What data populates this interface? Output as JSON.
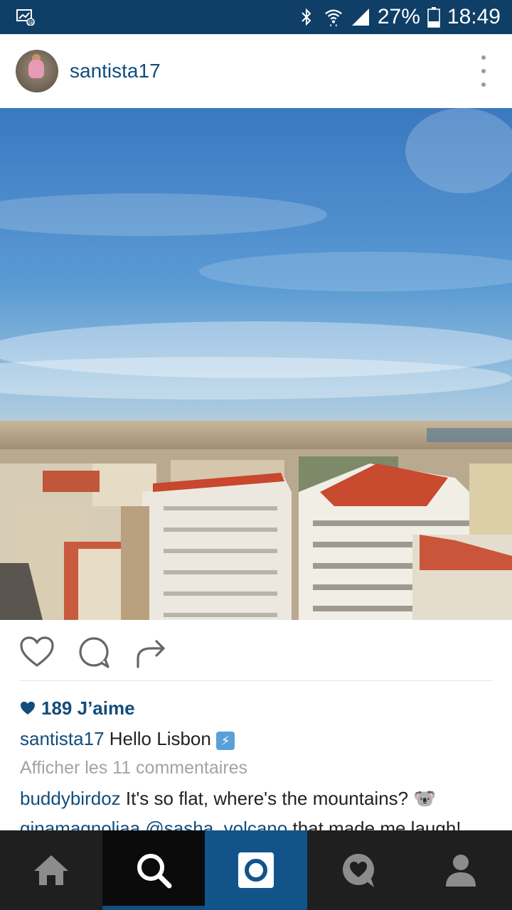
{
  "status_bar": {
    "battery": "27%",
    "time": "18:49",
    "icons": [
      "screen-cast-icon",
      "bluetooth-icon",
      "wifi-icon",
      "signal-icon",
      "battery-icon"
    ]
  },
  "post": {
    "username": "santista17",
    "likes": {
      "count_text": "189 J’aime"
    },
    "caption": {
      "user": "santista17",
      "text": "Hello Lisbon",
      "emoji": "⚡"
    },
    "view_comments": "Afficher les 11 commentaires",
    "comments": [
      {
        "user": "buddybirdoz",
        "text": "It's so flat, where's the mountains?",
        "emoji": "🐨"
      },
      {
        "user": "ginamagnoliaa",
        "mention": "@sasha_volcano",
        "text": "that made me laugh!"
      }
    ]
  },
  "bottom_nav": {
    "items": [
      "home-icon",
      "search-icon",
      "camera-icon",
      "activity-icon",
      "profile-icon"
    ],
    "active": "search"
  },
  "colors": {
    "status_bar": "#0f3e66",
    "accent": "#124d7c",
    "nav_bg": "#1f1f1f",
    "nav_active": "#0b0b0b",
    "camera_bg": "#12548a"
  }
}
